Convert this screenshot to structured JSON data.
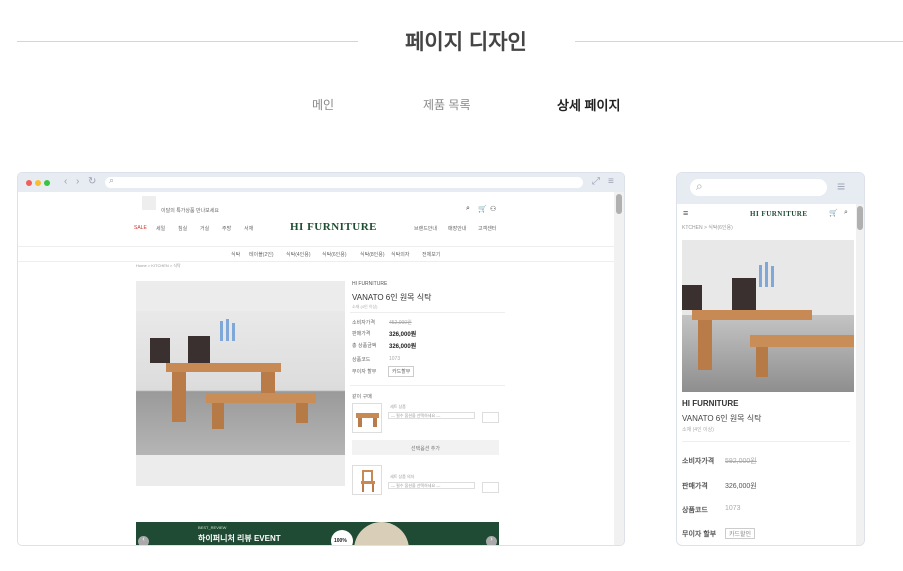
{
  "header": {
    "title": "페이지 디자인"
  },
  "tabs": [
    {
      "label": "메인"
    },
    {
      "label": "제품 목록"
    },
    {
      "label": "상세 페이지"
    }
  ],
  "desktop": {
    "promo": "이달의 특가상품 만나보세요",
    "brand": "HI FURNITURE",
    "nav": [
      "SALE",
      "세일",
      "침실",
      "거실",
      "주방",
      "서재"
    ],
    "util": [
      "브랜드안내",
      "매장안내",
      "고객센터"
    ],
    "subnav": [
      "식탁",
      "테이블(2인)",
      "식탁(4인용)",
      "식탁(6인용)",
      "식탁(8인용)",
      "식탁의자",
      "전체보기"
    ],
    "breadcrumb": "Home > KITCHEN > 식탁",
    "product": {
      "brand": "HI FURNITURE",
      "name": "VANATO 6인 원목 식탁",
      "sub": "소재 (4인 이상)",
      "consumer_price_label": "소비자가격",
      "consumer_price": "452,000원",
      "sale_price_label": "판매가격",
      "sale_price": "326,000원",
      "total_label": "총 상품금액",
      "total_price": "326,000원",
      "code_label": "상품코드",
      "code": "1073",
      "interest_label": "무이자 할부",
      "interest": "카드할부"
    },
    "options_title": "같이 구매",
    "option1_label": "세트 상품",
    "option1_placeholder": "— 필수 옵션을 선택하세요 —",
    "add_button": "선택옵션 추가",
    "option2_label": "세트 상품 의자",
    "option2_placeholder": "— 필수 옵션을 선택하세요 —",
    "banner": {
      "tag": "BEST_REVIEW",
      "title": "하이퍼니처 리뷰 EVENT",
      "badge": "100%"
    }
  },
  "mobile": {
    "brand": "HI FURNITURE",
    "breadcrumb": "KTCHEN > 식탁(6인용)",
    "product_brand": "HI FURNITURE",
    "product_name": "VANATO 6인 원목 식탁",
    "product_sub": "소재 (4인 이상)",
    "consumer_price_label": "소비자가격",
    "consumer_price": "592,000원",
    "sale_price_label": "판매가격",
    "sale_price": "326,000원",
    "code_label": "상품코드",
    "code": "1073",
    "interest_label": "무이자 할부",
    "interest": "카드할인"
  },
  "colors": {
    "brand_green": "#1f4d33",
    "frame": "#e7ebf2",
    "sale_red": "#d0342c"
  }
}
